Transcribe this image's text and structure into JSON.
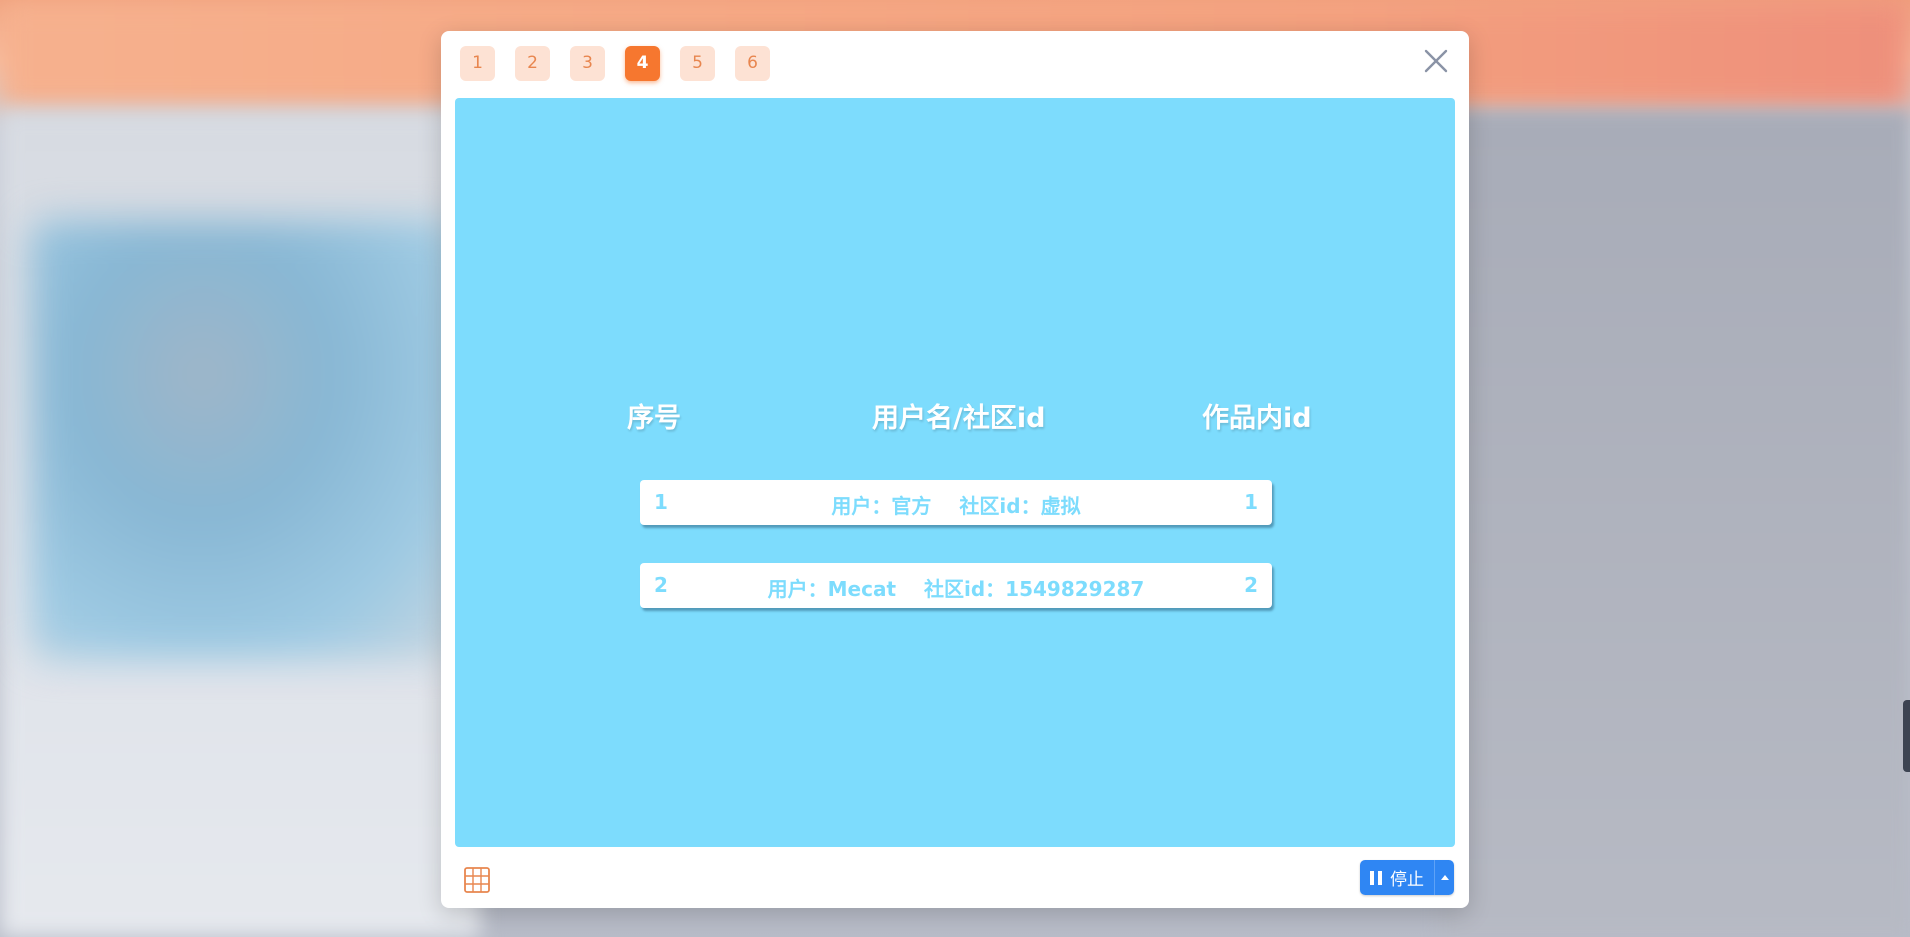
{
  "tabs": [
    "1",
    "2",
    "3",
    "4",
    "5",
    "6"
  ],
  "active_tab": "4",
  "table": {
    "headers": {
      "index": "序号",
      "user": "用户名/社区id",
      "work_id": "作品内id"
    },
    "rows": [
      {
        "index": "1",
        "user": "用户：官方",
        "community": "社区id：虚拟",
        "work_id": "1"
      },
      {
        "index": "2",
        "user": "用户：Mecat",
        "community": "社区id：1549829287",
        "work_id": "2"
      }
    ]
  },
  "footer": {
    "stop_label": "停止"
  },
  "colors": {
    "accent": "#f6772f",
    "tab_inactive": "#fde2d4",
    "stage": "#7ddcfd",
    "primary_button": "#2f86f3"
  },
  "icons": {
    "close": "close-icon",
    "grid": "grid-icon",
    "pause": "pause-icon",
    "caret": "caret-up-icon"
  }
}
